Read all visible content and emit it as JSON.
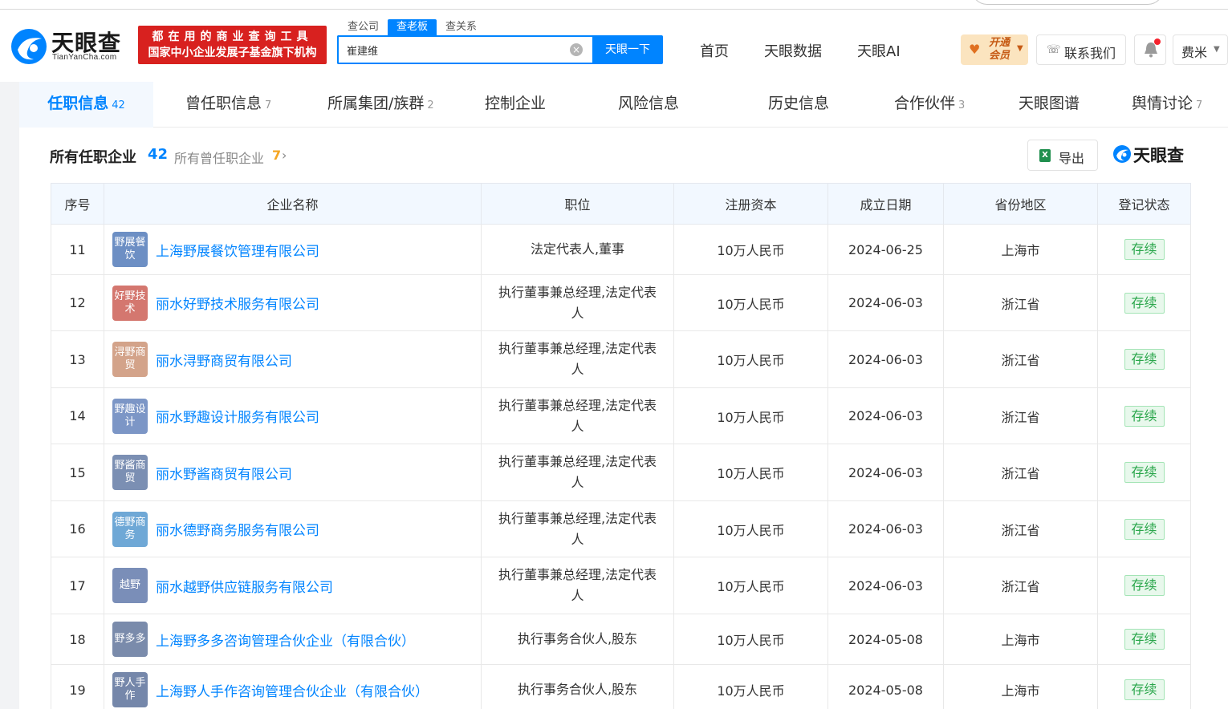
{
  "site": {
    "logo_text": "天眼查",
    "logo_sub": "TianYanCha.com",
    "promo_line1": "都在用的商业查询工具",
    "promo_line2": "国家中小企业发展子基金旗下机构",
    "colors": {
      "accent": "#0084ff",
      "promo": "#d8211f",
      "status_green": "#29a64a"
    }
  },
  "search": {
    "tabs": [
      "查公司",
      "查老板",
      "查关系"
    ],
    "active_tab": "查老板",
    "value": "崔建维",
    "button_label": "天眼一下"
  },
  "nav": {
    "links": [
      "首页",
      "天眼数据",
      "天眼AI"
    ],
    "vip_label": "开通会员",
    "contact_label": "联系我们",
    "user_label": "费米"
  },
  "tabs": [
    {
      "label": "任职信息",
      "count": "42"
    },
    {
      "label": "曾任职信息",
      "count": "7"
    },
    {
      "label": "所属集团/族群",
      "count": "2"
    },
    {
      "label": "控制企业",
      "count": ""
    },
    {
      "label": "风险信息",
      "count": ""
    },
    {
      "label": "历史信息",
      "count": ""
    },
    {
      "label": "合作伙伴",
      "count": "3"
    },
    {
      "label": "天眼图谱",
      "count": ""
    },
    {
      "label": "舆情讨论",
      "count": "7"
    }
  ],
  "section": {
    "title": "所有任职企业",
    "count": "42",
    "sub_label": "所有曾任职企业",
    "sub_count": "7",
    "export_label": "导出",
    "brand": "天眼查"
  },
  "table": {
    "headers": [
      "序号",
      "企业名称",
      "职位",
      "注册资本",
      "成立日期",
      "省份地区",
      "登记状态"
    ],
    "rows": [
      {
        "no": "11",
        "logo": "野展餐饮",
        "logo_color": "#6d8fc4",
        "name": "上海野展餐饮管理有限公司",
        "position": "法定代表人,董事",
        "capital": "10万人民币",
        "date": "2024-06-25",
        "region": "上海市",
        "status": "存续"
      },
      {
        "no": "12",
        "logo": "好野技术",
        "logo_color": "#d4776f",
        "name": "丽水好野技术服务有限公司",
        "position": "执行董事兼总经理,法定代表人",
        "capital": "10万人民币",
        "date": "2024-06-03",
        "region": "浙江省",
        "status": "存续"
      },
      {
        "no": "13",
        "logo": "浔野商贸",
        "logo_color": "#d3a38a",
        "name": "丽水浔野商贸有限公司",
        "position": "执行董事兼总经理,法定代表人",
        "capital": "10万人民币",
        "date": "2024-06-03",
        "region": "浙江省",
        "status": "存续"
      },
      {
        "no": "14",
        "logo": "野趣设计",
        "logo_color": "#7c96c6",
        "name": "丽水野趣设计服务有限公司",
        "position": "执行董事兼总经理,法定代表人",
        "capital": "10万人民币",
        "date": "2024-06-03",
        "region": "浙江省",
        "status": "存续"
      },
      {
        "no": "15",
        "logo": "野酱商贸",
        "logo_color": "#7b8fb3",
        "name": "丽水野酱商贸有限公司",
        "position": "执行董事兼总经理,法定代表人",
        "capital": "10万人民币",
        "date": "2024-06-03",
        "region": "浙江省",
        "status": "存续"
      },
      {
        "no": "16",
        "logo": "德野商务",
        "logo_color": "#6fa8d6",
        "name": "丽水德野商务服务有限公司",
        "position": "执行董事兼总经理,法定代表人",
        "capital": "10万人民币",
        "date": "2024-06-03",
        "region": "浙江省",
        "status": "存续"
      },
      {
        "no": "17",
        "logo": "越野",
        "logo_color": "#7a8eb8",
        "name": "丽水越野供应链服务有限公司",
        "position": "执行董事兼总经理,法定代表人",
        "capital": "10万人民币",
        "date": "2024-06-03",
        "region": "浙江省",
        "status": "存续"
      },
      {
        "no": "18",
        "logo": "野多多",
        "logo_color": "#7a8bab",
        "name": "上海野多多咨询管理合伙企业（有限合伙）",
        "position": "执行事务合伙人,股东",
        "capital": "10万人民币",
        "date": "2024-05-08",
        "region": "上海市",
        "status": "存续"
      },
      {
        "no": "19",
        "logo": "野人手作",
        "logo_color": "#7587aa",
        "name": "上海野人手作咨询管理合伙企业（有限合伙）",
        "position": "执行事务合伙人,股东",
        "capital": "10万人民币",
        "date": "2024-05-08",
        "region": "上海市",
        "status": "存续"
      }
    ]
  }
}
